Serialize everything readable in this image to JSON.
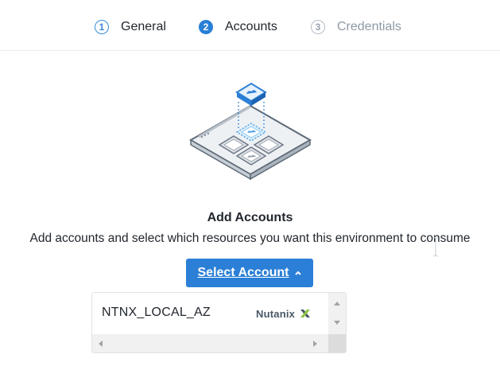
{
  "wizard": {
    "steps": [
      {
        "number": "1",
        "label": "General",
        "state": "done"
      },
      {
        "number": "2",
        "label": "Accounts",
        "state": "active"
      },
      {
        "number": "3",
        "label": "Credentials",
        "state": "pending"
      }
    ]
  },
  "main": {
    "illustration_icon": "layered-resources-icon",
    "title": "Add Accounts",
    "subtitle": "Add accounts and select which resources you want this environment to consume",
    "select_button_label": "Select Account",
    "select_button_icon": "caret-up-icon"
  },
  "dropdown": {
    "options": [
      {
        "name": "NTNX_LOCAL_AZ",
        "provider": "Nutanix",
        "provider_icon": "nutanix-x-icon"
      }
    ]
  },
  "colors": {
    "accent": "#2b7fd6",
    "nutanix_green": "#8bc53f"
  }
}
